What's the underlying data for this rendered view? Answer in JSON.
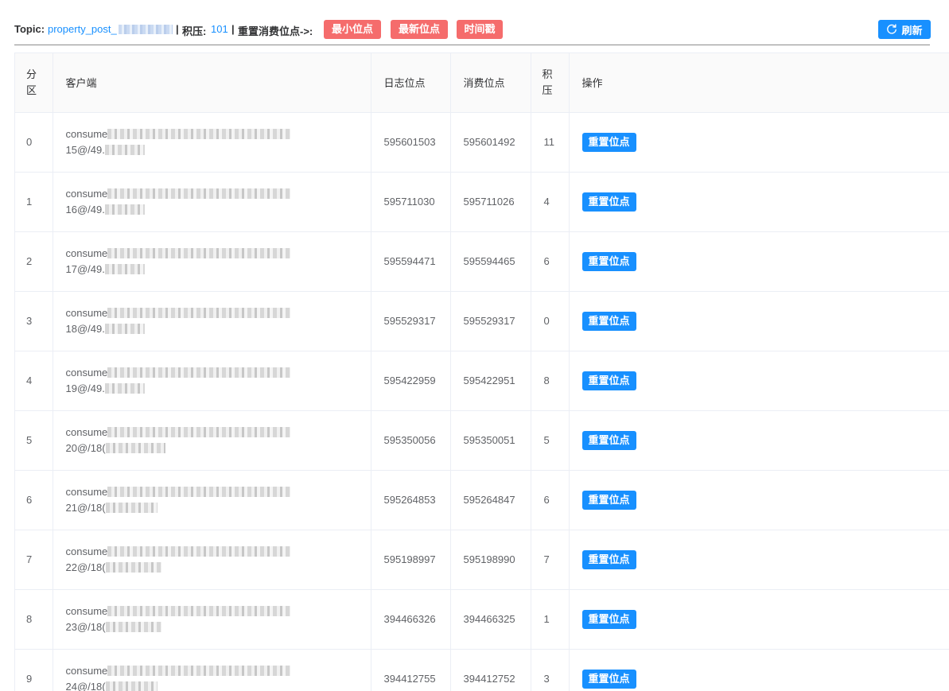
{
  "header": {
    "topic_label": "Topic:",
    "topic_value": "property_post_",
    "sep1": "|",
    "backlog_label": "积压:",
    "backlog_value": "101",
    "sep2": "|",
    "reset_label": "重置消费位点->:",
    "btn_min_offset": "最小位点",
    "btn_latest_offset": "最新位点",
    "btn_timestamp": "时间戳",
    "refresh_label": "刷新"
  },
  "table": {
    "headers": {
      "partition_line1": "分",
      "partition_line2": "区",
      "client": "客户端",
      "log_offset": "日志位点",
      "consume_offset": "消费位点",
      "lag_line1": "积",
      "lag_line2": "压",
      "action": "操作"
    },
    "action_label": "重置位点",
    "rows": [
      {
        "partition": "0",
        "client_prefix": "consume",
        "client_suffix": "15@/49.",
        "log_offset": "595601503",
        "consume_offset": "595601492",
        "lag": "11"
      },
      {
        "partition": "1",
        "client_prefix": "consume",
        "client_suffix": "16@/49.",
        "log_offset": "595711030",
        "consume_offset": "595711026",
        "lag": "4"
      },
      {
        "partition": "2",
        "client_prefix": "consume",
        "client_suffix": "17@/49.",
        "log_offset": "595594471",
        "consume_offset": "595594465",
        "lag": "6"
      },
      {
        "partition": "3",
        "client_prefix": "consume",
        "client_suffix": "18@/49.",
        "log_offset": "595529317",
        "consume_offset": "595529317",
        "lag": "0"
      },
      {
        "partition": "4",
        "client_prefix": "consume",
        "client_suffix": "19@/49.",
        "log_offset": "595422959",
        "consume_offset": "595422951",
        "lag": "8"
      },
      {
        "partition": "5",
        "client_prefix": "consume",
        "client_suffix": "20@/18(",
        "log_offset": "595350056",
        "consume_offset": "595350051",
        "lag": "5"
      },
      {
        "partition": "6",
        "client_prefix": "consume",
        "client_suffix": "21@/18(",
        "log_offset": "595264853",
        "consume_offset": "595264847",
        "lag": "6"
      },
      {
        "partition": "7",
        "client_prefix": "consume",
        "client_suffix": "22@/18(",
        "log_offset": "595198997",
        "consume_offset": "595198990",
        "lag": "7"
      },
      {
        "partition": "8",
        "client_prefix": "consume",
        "client_suffix": "23@/18(",
        "log_offset": "394466326",
        "consume_offset": "394466325",
        "lag": "1"
      },
      {
        "partition": "9",
        "client_prefix": "consume",
        "client_suffix": "24@/18(",
        "log_offset": "394412755",
        "consume_offset": "394412752",
        "lag": "3"
      }
    ]
  },
  "colors": {
    "primary": "#1890ff",
    "danger": "#f56c6c",
    "header_bg": "#fafafa",
    "border": "#ebeef5"
  },
  "icons": {
    "refresh": "refresh-icon"
  }
}
